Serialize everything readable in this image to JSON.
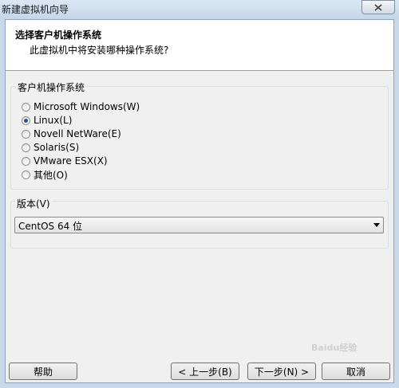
{
  "window": {
    "title": "新建虚拟机向导"
  },
  "header": {
    "title": "选择客户机操作系统",
    "subtitle": "此虚拟机中将安装哪种操作系统?"
  },
  "guest_os": {
    "label": "客户机操作系统",
    "options": [
      {
        "label": "Microsoft Windows(W)",
        "checked": false
      },
      {
        "label": "Linux(L)",
        "checked": true
      },
      {
        "label": "Novell NetWare(E)",
        "checked": false
      },
      {
        "label": "Solaris(S)",
        "checked": false
      },
      {
        "label": "VMware ESX(X)",
        "checked": false
      },
      {
        "label": "其他(O)",
        "checked": false
      }
    ]
  },
  "version": {
    "label": "版本(V)",
    "selected": "CentOS 64 位"
  },
  "buttons": {
    "help": "帮助",
    "back": "< 上一步(B)",
    "next": "下一步(N) >",
    "cancel": "取消"
  },
  "watermark": "Baidu经验"
}
